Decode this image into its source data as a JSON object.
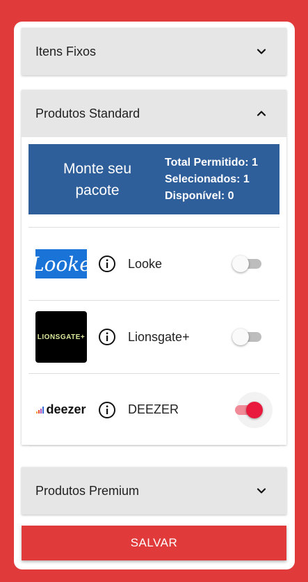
{
  "sections": {
    "fixos": {
      "title": "Itens Fixos",
      "expanded": false
    },
    "standard": {
      "title": "Produtos Standard",
      "expanded": true,
      "summary": {
        "heading_line1": "Monte seu",
        "heading_line2": "pacote",
        "total_permitido": "Total Permitido: 1",
        "selecionados": "Selecionados: 1",
        "disponivel": "Disponível: 0"
      },
      "products": [
        {
          "logo_text": "Looke",
          "name": "Looke",
          "enabled": false
        },
        {
          "logo_text": "LIONSGATE+",
          "name": "Lionsgate+",
          "enabled": false
        },
        {
          "logo_text": "deezer",
          "name": "DEEZER",
          "enabled": true
        }
      ]
    },
    "premium": {
      "title": "Produtos Premium",
      "expanded": false
    }
  },
  "save_label": "SALVAR",
  "colors": {
    "background": "#e03a3a",
    "summary_bg": "#2f5f9a",
    "toggle_on": "#e8193c",
    "header_bg": "#e6e6e6"
  },
  "icons": [
    "chevron-down-icon",
    "chevron-up-icon",
    "info-icon"
  ]
}
